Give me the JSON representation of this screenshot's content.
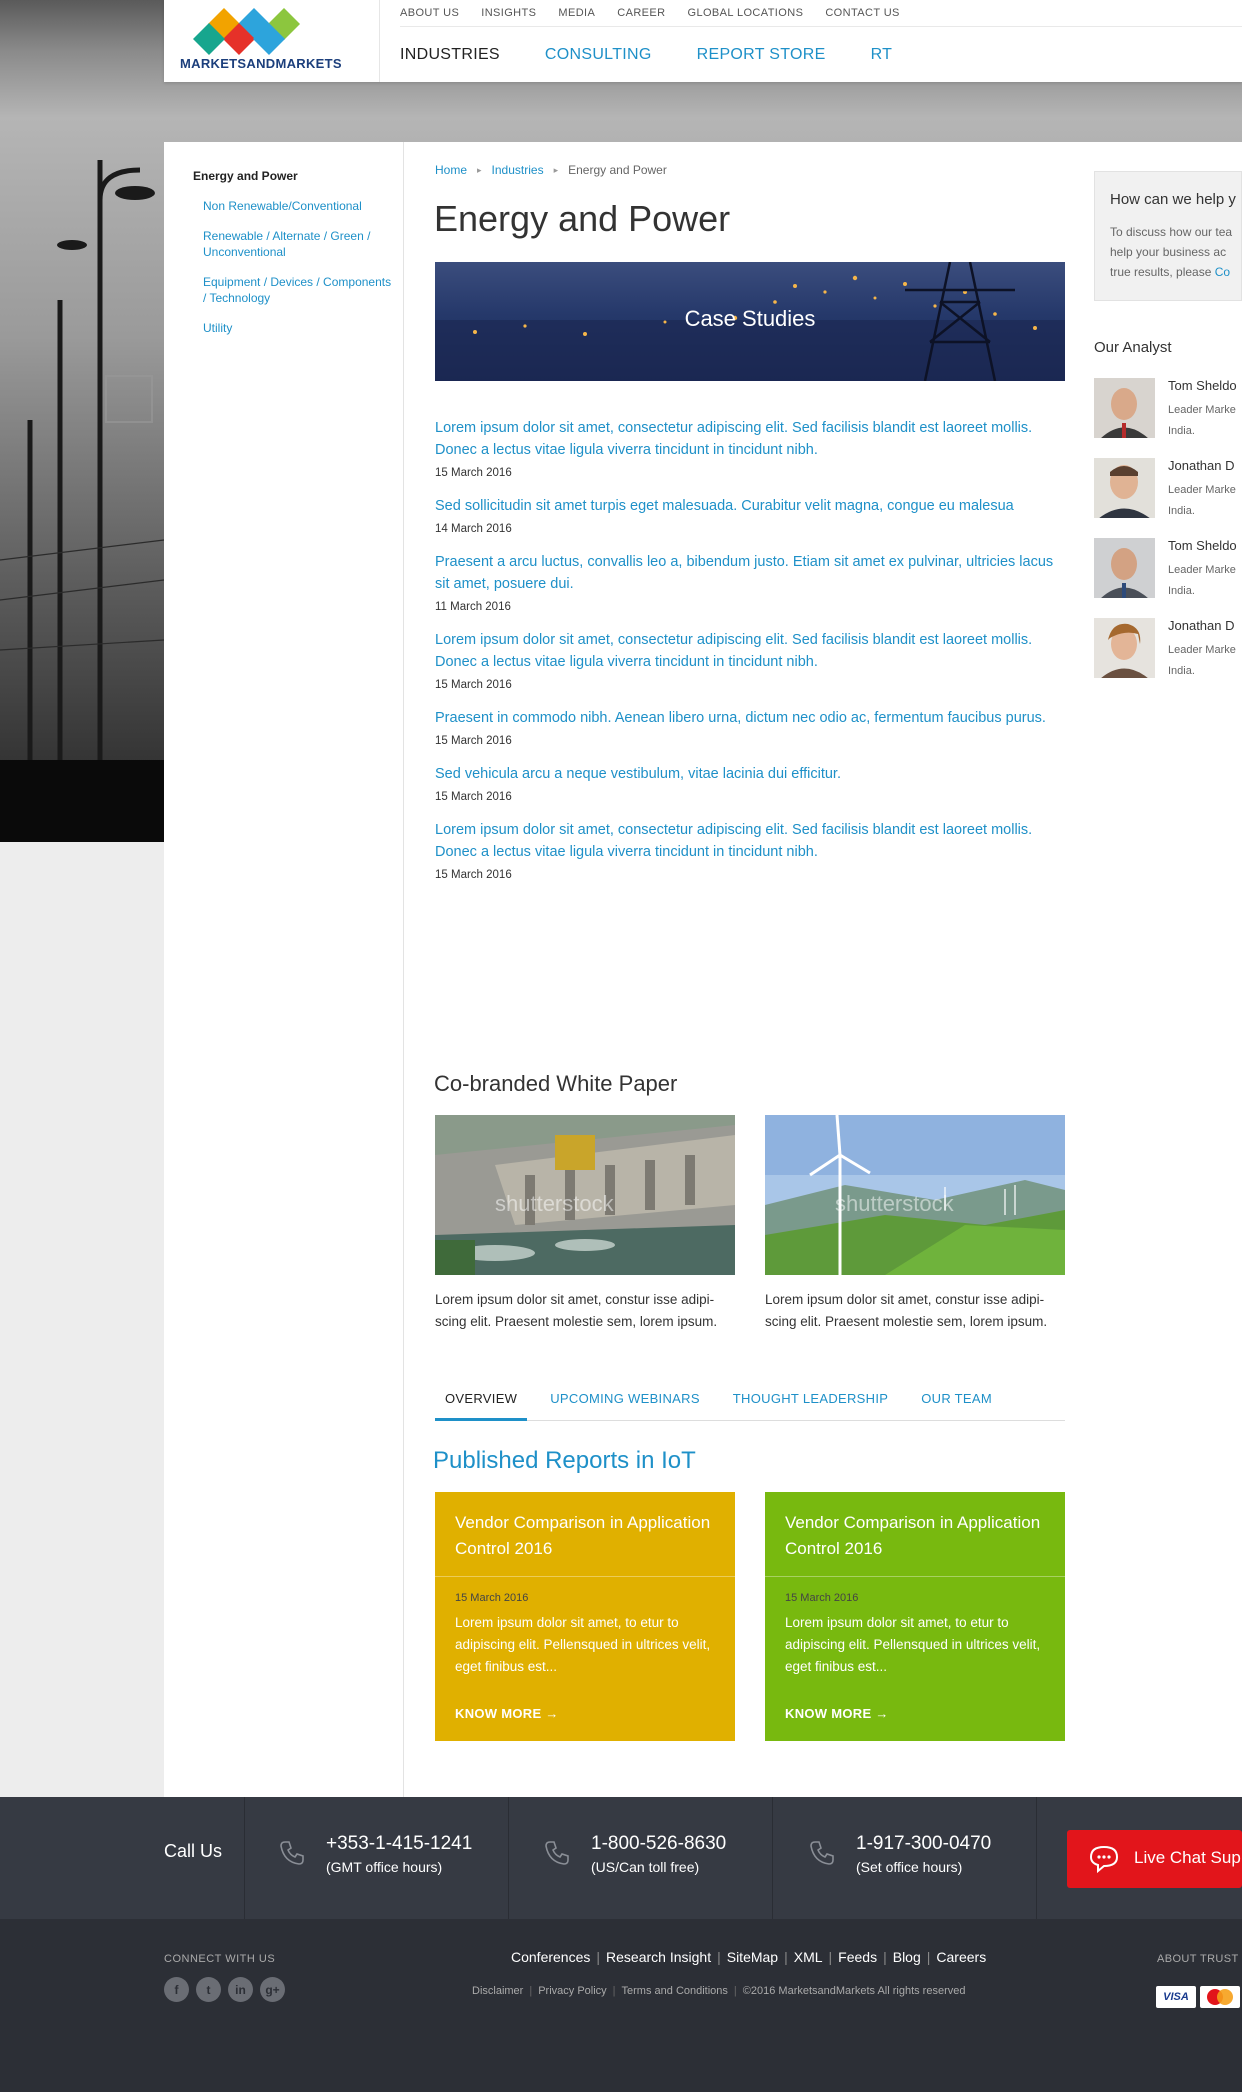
{
  "brand": {
    "logo_text": "MARKETSANDMARKETS"
  },
  "top_links": [
    "ABOUT US",
    "INSIGHTS",
    "MEDIA",
    "CAREER",
    "GLOBAL LOCATIONS",
    "CONTACT US"
  ],
  "main_nav": [
    "INDUSTRIES",
    "CONSULTING",
    "REPORT STORE",
    "RT"
  ],
  "sidebar": {
    "title": "Energy and Power",
    "items": [
      "Non Renewable/Conventional",
      "Renewable / Alternate / Green / Unconventional",
      "Equipment / Devices / Components / Technology",
      "Utility"
    ]
  },
  "breadcrumb": {
    "home": "Home",
    "industries": "Industries",
    "current": "Energy and Power"
  },
  "page_title": "Energy and Power",
  "banner": {
    "title": "Case Studies"
  },
  "case_studies": [
    {
      "title": "Lorem ipsum dolor sit amet, consectetur adipiscing elit. Sed facilisis blandit est laoreet mollis. Donec a lectus vitae ligula viverra tincidunt in tincidunt nibh.",
      "date": "15 March 2016"
    },
    {
      "title": "Sed sollicitudin sit amet turpis eget malesuada. Curabitur velit magna, congue eu malesua",
      "date": "14 March 2016"
    },
    {
      "title": "Praesent a arcu luctus, convallis leo a, bibendum justo. Etiam sit amet ex pulvinar, ultricies lacus sit amet, posuere dui.",
      "date": "11 March 2016"
    },
    {
      "title": "Lorem ipsum dolor sit amet, consectetur adipiscing elit. Sed facilisis blandit est laoreet mollis. Donec a lectus vitae ligula viverra tincidunt in tincidunt nibh.",
      "date": "15 March 2016"
    },
    {
      "title": "Praesent in commodo nibh. Aenean libero urna, dictum nec odio ac, fermentum faucibus purus.",
      "date": "15 March 2016"
    },
    {
      "title": "Sed vehicula arcu a neque vestibulum, vitae lacinia dui efficitur.",
      "date": "15 March 2016"
    },
    {
      "title": "Lorem ipsum dolor sit amet, consectetur adipiscing elit. Sed facilisis blandit est laoreet mollis. Donec a lectus vitae ligula viverra tincidunt in tincidunt nibh.",
      "date": "15 March 2016"
    }
  ],
  "white_paper": {
    "title": "Co-branded White Paper",
    "watermark": "shutterstock",
    "cards": [
      {
        "text": "Lorem ipsum dolor sit amet, constur isse adipi-scing elit. Praesent molestie sem, lorem ipsum."
      },
      {
        "text": "Lorem ipsum dolor sit amet, constur isse adipi-scing elit. Praesent molestie sem, lorem ipsum."
      }
    ]
  },
  "tabs": [
    "OVERVIEW",
    "UPCOMING WEBINARS",
    "THOUGHT LEADERSHIP",
    "OUR TEAM"
  ],
  "published": {
    "title": "Published Reports in IoT",
    "cards": [
      {
        "title": "Vendor Comparison in Application Control 2016",
        "date": "15 March 2016",
        "text": "Lorem ipsum dolor sit amet, to etur to adipiscing elit. Pellensqued in ultrices velit, eget finibus est...",
        "cta": "KNOW MORE →",
        "color": "#e0b000"
      },
      {
        "title": "Vendor Comparison in Application Control 2016",
        "date": "15 March 2016",
        "text": "Lorem ipsum dolor sit amet, to etur to adipiscing elit. Pellensqued in ultrices velit, eget finibus est...",
        "cta": "KNOW MORE →",
        "color": "#78b90f"
      }
    ]
  },
  "help": {
    "title": "How can we help y",
    "lines": [
      "To discuss how our tea",
      "help your business ac",
      "true results, please "
    ],
    "link": "Co"
  },
  "analyst": {
    "title": "Our Analyst",
    "people": [
      {
        "name": "Tom Sheldo",
        "role1": "Leader Marke",
        "role2": "India."
      },
      {
        "name": "Jonathan D",
        "role1": "Leader Marke",
        "role2": "India."
      },
      {
        "name": "Tom Sheldo",
        "role1": "Leader Marke",
        "role2": "India."
      },
      {
        "name": "Jonathan D",
        "role1": "Leader Marke",
        "role2": "India."
      }
    ]
  },
  "callbar": {
    "label": "Call Us",
    "numbers": [
      {
        "num": "+353-1-415-1241",
        "sub": "(GMT office hours)"
      },
      {
        "num": "1-800-526-8630",
        "sub": "(US/Can toll free)"
      },
      {
        "num": "1-917-300-0470",
        "sub": "(Set office hours)"
      }
    ],
    "live_chat": "Live Chat Sup"
  },
  "footer": {
    "connect": "CONNECT WITH US",
    "socials": [
      "f",
      "t",
      "in",
      "g+"
    ],
    "links": [
      "Conferences",
      "Research Insight",
      "SiteMap",
      "XML",
      "Feeds",
      "Blog",
      "Careers"
    ],
    "legal": [
      "Disclaimer",
      "Privacy Policy",
      "Terms and Conditions",
      "©2016 MarketsandMarkets All rights reserved"
    ],
    "about_trust": "ABOUT TRUST",
    "visa": "VISA"
  },
  "colors": {
    "accent": "#1e90c8",
    "yellow_card": "#e0b000",
    "green_card": "#78b90f",
    "live_chat": "#e2151b",
    "footer": "#2c2f36"
  }
}
